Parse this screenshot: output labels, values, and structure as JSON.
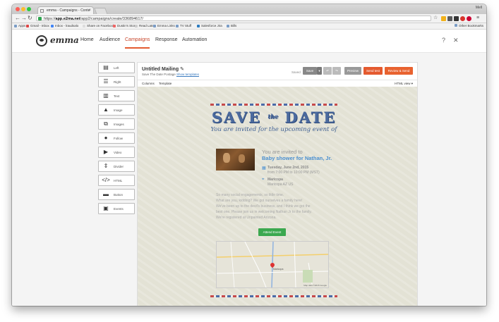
{
  "browser": {
    "tab_title": "emma - Campaigns - Conte",
    "profile": "Mell",
    "url_prefix": "https://",
    "url_host": "app.e2ma.net",
    "url_path": "/app2/campaigns/create/336894617/",
    "bookmarks": [
      "Apps",
      "Gmail - Inbox",
      "Inbox - lraudsalo",
      "Share on Facebook",
      "Dustin's Story",
      "Read Later",
      "Emma Links",
      "TV Stuff",
      "Salesforce Jira",
      "Bills"
    ],
    "other_bookmarks": "Other Bookmarks"
  },
  "app": {
    "logo": "emma",
    "nav": [
      "Home",
      "Audience",
      "Campaigns",
      "Response",
      "Automation"
    ],
    "active_nav": "Campaigns"
  },
  "palette": [
    "Left",
    "Right",
    "Text",
    "Image",
    "Images",
    "Follow",
    "Video",
    "Divider",
    "HTML",
    "Button",
    "Events"
  ],
  "editor": {
    "title": "Untitled Mailing",
    "subtitle": "Save The Date Postage",
    "subtitle_link": "Show templates",
    "saved": "Saved",
    "buttons": {
      "save": "Save",
      "preview": "Preview",
      "send_test": "Send test",
      "review_send": "Review & Send"
    },
    "tabs": [
      "Columns",
      "Template"
    ],
    "view_select": "HTML view"
  },
  "email": {
    "headline_left": "SAVE",
    "headline_the": "the",
    "headline_right": "DATE",
    "script_line": "You are invited for the upcoming event of",
    "intro": "You are invited to",
    "event_name": "Baby shower for Nathan, Jr.",
    "date": "Tuesday, June 2nd, 2015",
    "time": "from 7:00 PM to 10:00 PM (MST)",
    "place": "Maricopa",
    "place_sub": "Maricopa AZ US",
    "paragraph": [
      "So many social engagements, so little time.",
      "What are you, kidding? We got ourselves a family here!",
      "We've been up to the devil's business, and I think we got the",
      "best one. Please join us in welcoming Nathan Jr to the family.",
      "We're registered at Unpainted Arizona."
    ],
    "attend_button": "Attend Event",
    "map_label": "Maricopa",
    "map_credit": "Map data ©2015 Google"
  },
  "colors": {
    "accent": "#e45a2f",
    "send_test": "#e45a2f",
    "review_send": "#e8622f",
    "attend": "#3ba84f",
    "link": "#4a8fd0"
  }
}
